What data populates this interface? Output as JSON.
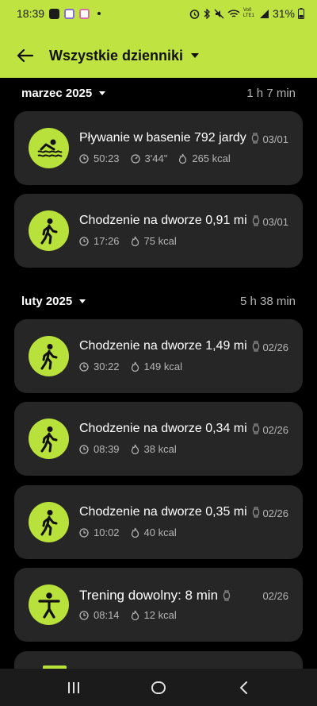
{
  "status_bar": {
    "time": "18:39",
    "signal_label": "Vo0 LTE1",
    "battery": "31%"
  },
  "header": {
    "title": "Wszystkie dzienniki",
    "back_icon": "arrow-left-icon"
  },
  "colors": {
    "accent": "#bfe340",
    "card_bg": "#262626",
    "icon_bg": "#b9e13b"
  },
  "months": [
    {
      "label": "marzec 2025",
      "total": "1 h 7 min",
      "entries": [
        {
          "icon": "swimming-icon",
          "title": "Pływanie w basenie 792 jardy",
          "date": "03/01",
          "stats": [
            {
              "icon": "clock-icon",
              "value": "50:23"
            },
            {
              "icon": "pace-icon",
              "value": "3'44\""
            },
            {
              "icon": "flame-icon",
              "value": "265 kcal"
            }
          ]
        },
        {
          "icon": "walking-icon",
          "title": "Chodzenie na dworze 0,91 mi",
          "date": "03/01",
          "stats": [
            {
              "icon": "clock-icon",
              "value": "17:26"
            },
            {
              "icon": "flame-icon",
              "value": "75 kcal"
            }
          ]
        }
      ]
    },
    {
      "label": "luty 2025",
      "total": "5 h 38 min",
      "entries": [
        {
          "icon": "walking-icon",
          "title": "Chodzenie na dworze 1,49 mi",
          "date": "02/26",
          "stats": [
            {
              "icon": "clock-icon",
              "value": "30:22"
            },
            {
              "icon": "flame-icon",
              "value": "149 kcal"
            }
          ]
        },
        {
          "icon": "walking-icon",
          "title": "Chodzenie na dworze 0,34 mi",
          "date": "02/26",
          "stats": [
            {
              "icon": "clock-icon",
              "value": "08:39"
            },
            {
              "icon": "flame-icon",
              "value": "38 kcal"
            }
          ]
        },
        {
          "icon": "walking-icon",
          "title": "Chodzenie na dworze 0,35 mi",
          "date": "02/26",
          "stats": [
            {
              "icon": "clock-icon",
              "value": "10:02"
            },
            {
              "icon": "flame-icon",
              "value": "40 kcal"
            }
          ]
        },
        {
          "icon": "person-icon",
          "title": "Trening dowolny: 8 min",
          "date": "02/26",
          "stats": [
            {
              "icon": "clock-icon",
              "value": "08:14"
            },
            {
              "icon": "flame-icon",
              "value": "12 kcal"
            }
          ]
        }
      ]
    }
  ],
  "nav_bar": {
    "recents_icon": "recents-icon",
    "home_icon": "home-icon",
    "back_icon": "back-chevron-icon"
  }
}
